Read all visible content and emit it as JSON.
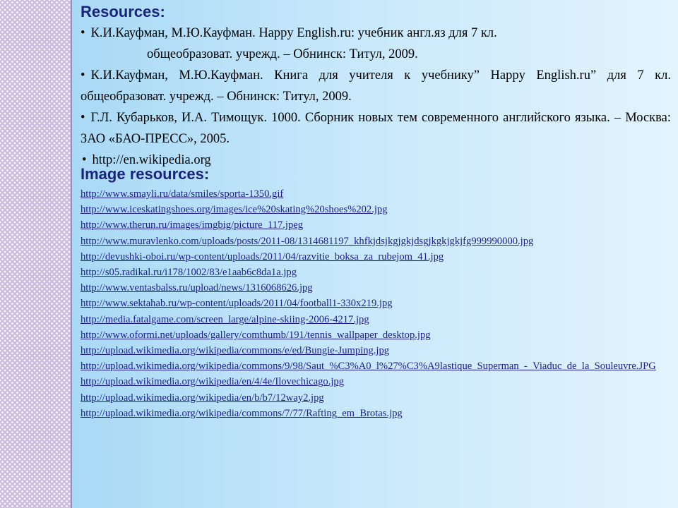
{
  "resources_title": "Resources:",
  "resources": [
    {
      "line1": "К.И.Кауфман, М.Ю.Кауфман. Happy English.ru: учебник англ.яз для 7 кл.",
      "line2": "общеобразоват. учрежд. – Обнинск: Титул, 2009."
    },
    {
      "text": "К.И.Кауфман, М.Ю.Кауфман. Книга для учителя к учебнику” Happy English.ru” для 7 кл. общеобразоват. учрежд. – Обнинск: Титул, 2009."
    },
    {
      "text": "Г.Л. Кубарьков, И.А. Тимощук. 1000. Сборник новых тем современного английского языка. – Москва: ЗАО «БАО-ПРЕСС», 2005."
    },
    {
      "text": "http://en.wikipedia.org"
    }
  ],
  "bullet": "•",
  "image_resources_title": "Image resources:",
  "image_links": [
    "http://www.smayli.ru/data/smiles/sporta-1350.gif",
    "http://www.iceskatingshoes.org/images/ice%20skating%20shoes%202.jpg",
    "http://www.therun.ru/images/imgbig/picture_117.jpeg",
    "http://www.muravlenko.com/uploads/posts/2011-08/1314681197_khfkjdsjkgjgkjdsgjkgkjgkjfg999990000.jpg",
    "http://devushki-oboi.ru/wp-content/uploads/2011/04/razvitie_boksa_za_rubejom_41.jpg",
    "http://s05.radikal.ru/i178/1002/83/e1aab6c8da1a.jpg",
    "http://www.ventasbalss.ru/upload/news/1316068626.jpg",
    "http://www.sektahab.ru/wp-content/uploads/2011/04/football1-330x219.jpg",
    "http://media.fatalgame.com/screen_large/alpine-skiing-2006-4217.jpg",
    "http://www.oformi.net/uploads/gallery/comthumb/191/tennis_wallpaper_desktop.jpg",
    "http://upload.wikimedia.org/wikipedia/commons/e/ed/Bungie-Jumping.jpg",
    "http://upload.wikimedia.org/wikipedia/commons/9/98/Saut_%C3%A0_l%27%C3%A9lastique_Superman_-_Viaduc_de_la_Souleuvre.JPG",
    "http://upload.wikimedia.org/wikipedia/en/4/4e/Ilovechicago.jpg",
    " http://upload.wikimedia.org/wikipedia/en/b/b7/12way2.jpg",
    "http://upload.wikimedia.org/wikipedia/commons/7/77/Rafting_em_Brotas.jpg"
  ]
}
